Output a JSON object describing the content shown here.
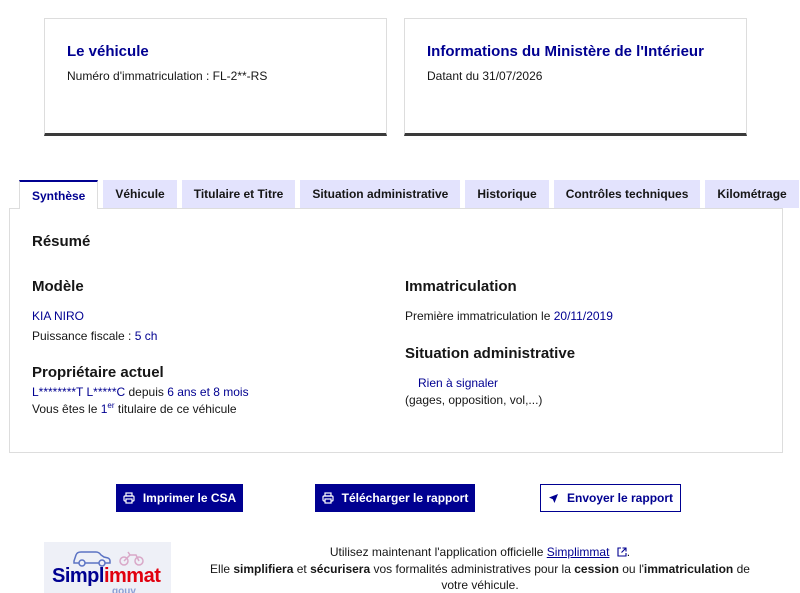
{
  "vehicle_card": {
    "title": "Le véhicule",
    "plate_label": "Numéro d'immatriculation : FL-2**-RS"
  },
  "ministry_card": {
    "title": "Informations du Ministère de l'Intérieur",
    "date_label": "Datant du 31/07/2026"
  },
  "tabs": [
    {
      "label": "Synthèse",
      "active": true
    },
    {
      "label": "Véhicule",
      "active": false
    },
    {
      "label": "Titulaire et Titre",
      "active": false
    },
    {
      "label": "Situation administrative",
      "active": false
    },
    {
      "label": "Historique",
      "active": false
    },
    {
      "label": "Contrôles techniques",
      "active": false
    },
    {
      "label": "Kilométrage",
      "active": false
    }
  ],
  "summary": {
    "title": "Résumé",
    "model": {
      "title": "Modèle",
      "name": "KIA NIRO",
      "power_label": "Puissance fiscale : ",
      "power_value": "5 ch"
    },
    "owner": {
      "title": "Propriétaire actuel",
      "name": "L********T L*****C",
      "since_label": " depuis ",
      "since_value": "6 ans et 8 mois",
      "holder_prefix": "Vous êtes le ",
      "holder_rank": "1",
      "holder_sup": "er",
      "holder_suffix": " titulaire de ce véhicule"
    },
    "registration": {
      "title": "Immatriculation",
      "first_label": "Première immatriculation le ",
      "first_value": "20/11/2019"
    },
    "admin": {
      "title": "Situation administrative",
      "status": "Rien à signaler",
      "details": "(gages, opposition, vol,...)"
    }
  },
  "buttons": {
    "print": "Imprimer le CSA",
    "download": "Télécharger le rapport",
    "send": "Envoyer le rapport"
  },
  "promo": {
    "logo_text_a": "Simpl",
    "logo_text_b": "immat",
    "logo_sub": "gouv",
    "line1_prefix": "Utilisez maintenant l'application officielle ",
    "link": "Simplimmat",
    "line1_suffix": ".",
    "line2_a": "Elle ",
    "line2_b": "simplifiera",
    "line2_c": " et ",
    "line2_d": "sécurisera",
    "line2_e": " vos formalités administratives pour la ",
    "line2_f": "cession",
    "line2_g": " ou l'",
    "line2_h": "immatriculation",
    "line2_i": " de",
    "line3": "votre véhicule."
  },
  "colors": {
    "primary": "#000091",
    "tab_bg": "#e3e3fd",
    "logo_red": "#e1000f"
  }
}
